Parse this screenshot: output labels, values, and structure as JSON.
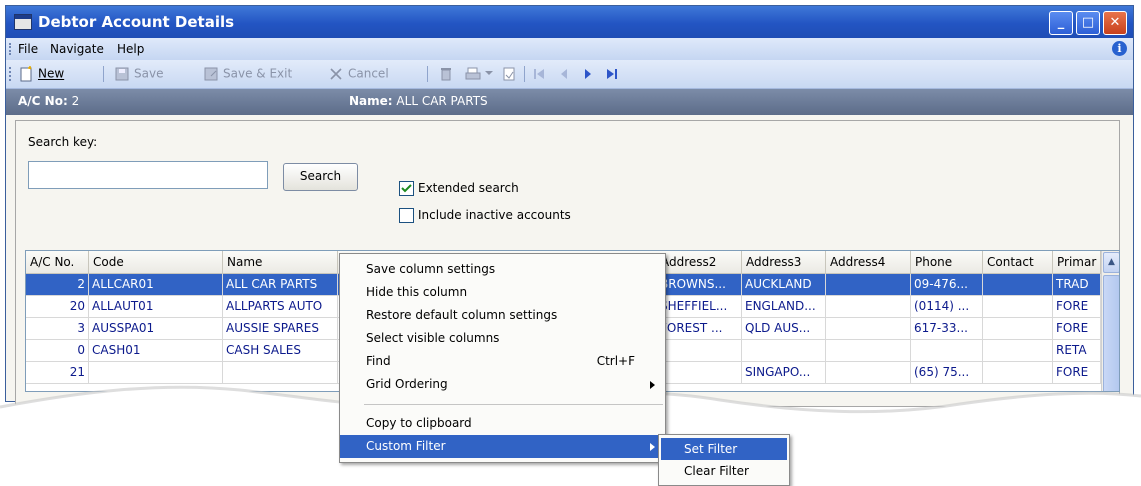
{
  "window": {
    "title": "Debtor Account Details"
  },
  "menubar": {
    "items": [
      "File",
      "Navigate",
      "Help"
    ]
  },
  "toolbar": {
    "new": "New",
    "save": "Save",
    "save_exit": "Save & Exit",
    "cancel": "Cancel"
  },
  "header": {
    "acno_label": "A/C No:",
    "acno_value": "2",
    "name_label": "Name:",
    "name_value": "ALL CAR PARTS"
  },
  "search": {
    "key_label": "Search key:",
    "key_value": "",
    "button": "Search",
    "extended_label": "Extended search",
    "extended_checked": true,
    "inactive_label": "Include inactive accounts",
    "inactive_checked": false
  },
  "grid": {
    "columns": [
      "A/C No.",
      "Code",
      "Name",
      "",
      "",
      "Address2",
      "Address3",
      "Address4",
      "Phone",
      "Contact",
      "Primar"
    ],
    "rows": [
      {
        "acno": "2",
        "code": "ALLCAR01",
        "name": "ALL CAR PARTS",
        "address2": "BROWNS...",
        "address3": "AUCKLAND",
        "address4": "",
        "phone": "09-476...",
        "contact": "",
        "primary": "TRAD",
        "selected": true
      },
      {
        "acno": "20",
        "code": "ALLAUT01",
        "name": "ALLPARTS AUTO",
        "address2": "SHEFFIEL...",
        "address3": "ENGLAND...",
        "address4": "",
        "phone": "(0114) ...",
        "contact": "",
        "primary": "FORE",
        "selected": false
      },
      {
        "acno": "3",
        "code": "AUSSPA01",
        "name": "AUSSIE SPARES",
        "address2": "FOREST ...",
        "address3": "QLD AUS...",
        "address4": "",
        "phone": "617-33...",
        "contact": "",
        "primary": "FORE",
        "selected": false
      },
      {
        "acno": "0",
        "code": "CASH01",
        "name": "CASH SALES",
        "address2": "",
        "address3": "",
        "address4": "",
        "phone": "",
        "contact": "",
        "primary": "RETA",
        "selected": false
      },
      {
        "acno": "21",
        "code": "",
        "name": "",
        "address2": "",
        "address3": "SINGAPO...",
        "address4": "",
        "phone": "(65) 75...",
        "contact": "",
        "primary": "FORE",
        "selected": false
      }
    ]
  },
  "context_menu": {
    "items": [
      {
        "label": "Save column settings",
        "shortcut": ""
      },
      {
        "label": "Hide this column",
        "shortcut": ""
      },
      {
        "label": "Restore default column settings",
        "shortcut": ""
      },
      {
        "label": "Select visible columns",
        "shortcut": ""
      },
      {
        "label": "Find",
        "shortcut": "Ctrl+F"
      },
      {
        "label": "Grid Ordering",
        "shortcut": ""
      },
      {
        "label": "Copy to clipboard",
        "shortcut": ""
      },
      {
        "label": "Custom Filter",
        "shortcut": ""
      }
    ]
  },
  "submenu": {
    "items": [
      "Set Filter",
      "Clear Filter"
    ]
  },
  "colors": {
    "title_blue": "#2355c3",
    "selection": "#3163c5",
    "header_gray": "#5c6c89"
  }
}
